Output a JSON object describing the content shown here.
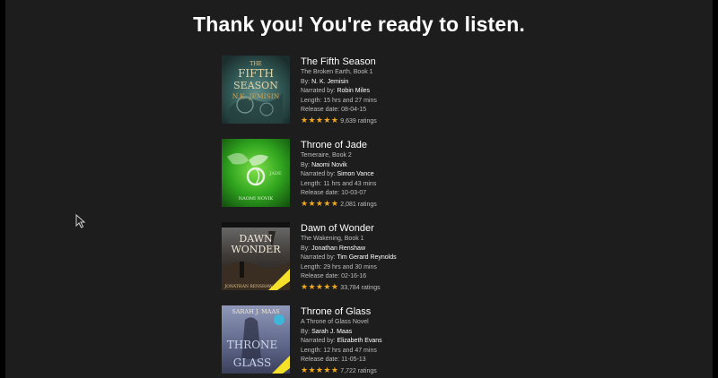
{
  "page": {
    "title": "Thank you! You're ready to listen."
  },
  "labels": {
    "by": "By:",
    "narrated_by": "Narrated by:",
    "length": "Length:",
    "release_date": "Release date:"
  },
  "books": [
    {
      "title": "The Fifth Season",
      "series": "The Broken Earth, Book 1",
      "author": "N. K. Jemisin",
      "narrator": "Robin Miles",
      "length": "15 hrs and 27 mins",
      "release_date": "08-04-15",
      "stars": "★★★★★",
      "ratings": "9,639 ratings",
      "cover_text_top": "THE",
      "cover_text_title": "FIFTH",
      "cover_text_title2": "SEASON",
      "cover_text_author": "N.K. JEMISIN"
    },
    {
      "title": "Throne of Jade",
      "series": "Temeraire, Book 2",
      "author": "Naomi Novik",
      "narrator": "Simon Vance",
      "length": "11 hrs and 43 mins",
      "release_date": "10-03-07",
      "stars": "★★★★★",
      "ratings": "2,081 ratings",
      "cover_text_title": "JADE",
      "cover_text_author": "NAOMI NOVIK"
    },
    {
      "title": "Dawn of Wonder",
      "series": "The Wakening, Book 1",
      "author": "Jonathan Renshaw",
      "narrator": "Tim Gerard Reynolds",
      "length": "29 hrs and 30 mins",
      "release_date": "02-16-16",
      "stars": "★★★★★",
      "ratings": "33,784 ratings",
      "cover_text_title": "DAWN",
      "cover_text_title2": "WONDER",
      "cover_text_author": "JONATHAN RENSHAW"
    },
    {
      "title": "Throne of Glass",
      "series": "A Throne of Glass Novel",
      "author": "Sarah J. Maas",
      "narrator": "Elizabeth Evans",
      "length": "Length: 12 hrs and 47 mins",
      "release_date": "11-05-13",
      "stars": "★★★★★",
      "ratings": "7,722 ratings",
      "cover_text_author": "SARAH J. MAAS",
      "cover_text_title": "THRONE",
      "cover_text_title2": "GLASS"
    }
  ],
  "colors": {
    "background": "#1d1d1d",
    "star": "#f0a81e",
    "title_text": "#ffffff",
    "meta_text": "#bdbdbd"
  }
}
